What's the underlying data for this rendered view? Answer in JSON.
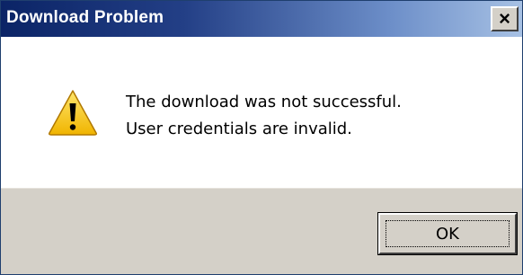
{
  "window": {
    "title": "Download Problem",
    "close_glyph": "×",
    "title_color": "#ffffff",
    "titlebar_start_color": "#0b2466",
    "titlebar_end_color": "#a7c1e4"
  },
  "dialog": {
    "icon": "warning-icon",
    "message_lines": [
      "The download was not successful.",
      "User credentials are invalid."
    ]
  },
  "buttons": {
    "ok_label": "OK"
  }
}
